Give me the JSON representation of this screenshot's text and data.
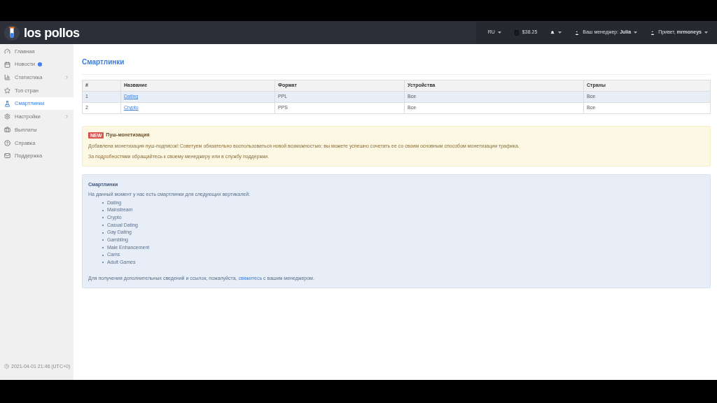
{
  "header": {
    "logo": "los pollos",
    "nav": [
      {
        "kind": "text",
        "label": "RU",
        "caret": true
      },
      {
        "kind": "balance",
        "label": "$38.25",
        "caret": false
      },
      {
        "kind": "bell",
        "caret": true
      },
      {
        "kind": "user",
        "label": "Ваш менеджер: **Julia**",
        "caret": true
      },
      {
        "kind": "user",
        "label": "Привет, **mrmoneys**",
        "caret": true
      }
    ]
  },
  "sidebar": {
    "items": [
      {
        "label": "Главная",
        "selected": false,
        "submenu": false,
        "info": false
      },
      {
        "label": "Новости",
        "selected": false,
        "submenu": false,
        "info": true
      },
      {
        "label": "Статистика",
        "selected": false,
        "submenu": true,
        "info": false
      },
      {
        "label": "Топ стран",
        "selected": false,
        "submenu": false,
        "info": false
      },
      {
        "label": "Смартлинки",
        "selected": true,
        "submenu": false,
        "info": false
      },
      {
        "label": "Настройки",
        "selected": false,
        "submenu": true,
        "info": false
      },
      {
        "label": "Выплаты",
        "selected": false,
        "submenu": false,
        "info": false
      },
      {
        "label": "Справка",
        "selected": false,
        "submenu": false,
        "info": false
      },
      {
        "label": "Поддержка",
        "selected": false,
        "submenu": false,
        "info": false
      }
    ],
    "timestamp": "2021-04-01 21:46 (UTC+0)"
  },
  "page_title": "Смартлинки",
  "table": {
    "columns": [
      "#",
      "Название",
      "Формат",
      "Устройства",
      "Страны"
    ],
    "rows": [
      {
        "cells": [
          "1",
          "Dating",
          "PPL",
          "Все",
          "Все"
        ],
        "highlighted": true
      },
      {
        "cells": [
          "2",
          "Crypto",
          "PPS",
          "Все",
          "Все"
        ],
        "highlighted": false
      }
    ]
  },
  "alert": {
    "badge": "NEW",
    "title": "Пуш-монетизация",
    "lines": [
      "Добавлена монетизация пуш-подписок! Советуем обязательно воспользоваться новой возможностью: вы можете успешно сочетать ее со своим основным способом монетизации трафика.",
      "За подробностями обращайтесь к своему менеджеру или в службу поддержки."
    ]
  },
  "info": {
    "title": "Смартлинки",
    "intro": "На данный момент у нас есть смартлинки для следующих вертикалей:",
    "verticals": [
      "Dating",
      "Mainstream",
      "Crypto",
      "Casual Dating",
      "Gay Dating",
      "Gambling",
      "Male Enhancement",
      "Cams",
      "Adult Games"
    ],
    "footer_before": "Для получения дополнительных сведений и ссылок, пожалуйста,",
    "footer_link": "свяжитесь",
    "footer_after": "с вашим менеджером."
  }
}
